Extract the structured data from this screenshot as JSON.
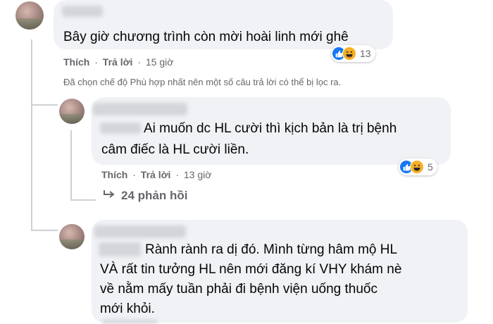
{
  "comments": [
    {
      "text_lines": [
        "Bây giờ chương trình còn mời hoài linh mới ghê"
      ],
      "like_label": "Thích",
      "reply_label": "Trả lời",
      "time": "15 giờ",
      "reaction_count": "13"
    },
    {
      "text_lines": [
        "Ai muốn dc HL cười thì kịch bản là trị bệnh",
        "câm điếc là HL cười liền."
      ],
      "like_label": "Thích",
      "reply_label": "Trả lời",
      "time": "13 giờ",
      "reaction_count": "5"
    },
    {
      "text_lines": [
        "Rành rành ra dị đó. Mình từng hâm mộ HL",
        "VÀ rất tin tưởng HL nên mới đăng kí VHY khám nè",
        "về nằm mấy tuần phải đi bệnh viện uống thuốc",
        "mới khỏi."
      ]
    }
  ],
  "filter_note": "Đã chọn chế độ Phù hợp nhất nên một số câu trả lời có thể bị lọc ra.",
  "view_replies": "24 phản hồi",
  "separator": "·",
  "reactions": [
    "like-icon",
    "haha-icon"
  ],
  "colors": {
    "bubble": "#f0f2f5",
    "meta": "#65676b",
    "like": "#1877f2",
    "haha": "#f7b125"
  }
}
